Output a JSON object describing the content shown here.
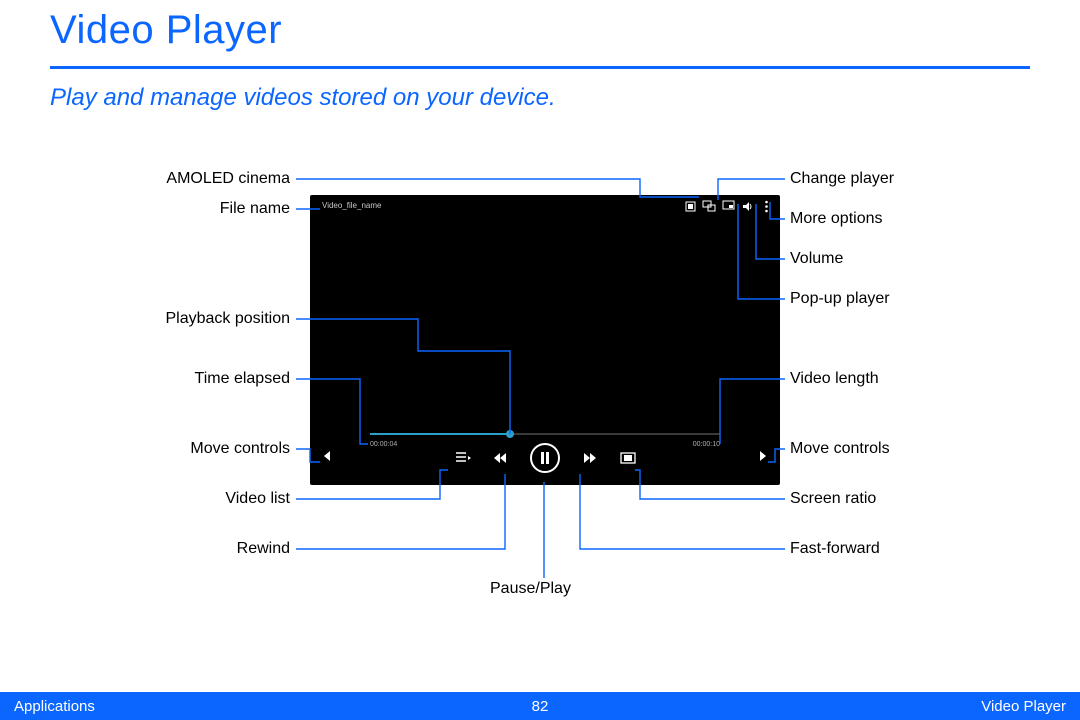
{
  "title": "Video Player",
  "subtitle": "Play and manage videos stored on your device.",
  "player": {
    "filename": "Video_file_name",
    "elapsed": "00:00:04",
    "total": "00:00:10"
  },
  "labels": {
    "left": {
      "amoled": "AMOLED cinema",
      "filename": "File name",
      "playback_position": "Playback position",
      "time_elapsed": "Time elapsed",
      "move_controls": "Move controls",
      "video_list": "Video list",
      "rewind": "Rewind"
    },
    "right": {
      "change_player": "Change player",
      "more_options": "More options",
      "volume": "Volume",
      "popup": "Pop-up player",
      "video_length": "Video length",
      "move_controls": "Move controls",
      "screen_ratio": "Screen ratio",
      "fast_forward": "Fast-forward"
    },
    "bottom": {
      "pause_play": "Pause/Play"
    }
  },
  "footer": {
    "left": "Applications",
    "page": "82",
    "right": "Video Player"
  }
}
